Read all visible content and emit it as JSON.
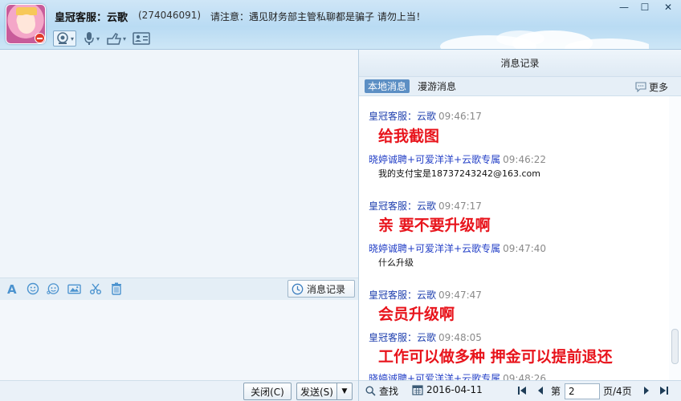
{
  "header": {
    "contact_name": "皇冠客服：云歌",
    "contact_id": "(274046091)",
    "notice": "请注意：遇见财务部主管私聊都是骗子 请勿上当！"
  },
  "toolbar": {
    "icons": [
      "video-icon",
      "microphone-icon",
      "share-icon",
      "contact-card-icon"
    ]
  },
  "window_controls": {
    "minimize": "—",
    "maximize": "☐",
    "close": "✕"
  },
  "input_toolbar": {
    "icons": [
      "font-icon",
      "emoji-icon",
      "magic-emoji-icon",
      "image-icon",
      "screenshot-icon",
      "trash-icon"
    ],
    "history_label": "消息记录"
  },
  "bottom": {
    "close_label": "关闭(C)",
    "send_label": "发送(S)"
  },
  "history": {
    "title": "消息记录",
    "tabs": [
      "本地消息",
      "漫游消息"
    ],
    "more_label": "更多",
    "messages": [
      {
        "sender": "皇冠客服：云歌",
        "time": "09:46:17",
        "text": "给我截图",
        "style": "big",
        "from": "cs"
      },
      {
        "sender": "晓婷诚聘+可爱洋洋+云歌专属",
        "time": "09:46:22",
        "text": "我的支付宝是18737243242@163.com",
        "style": "small",
        "from": "me"
      },
      {
        "sender": "皇冠客服：云歌",
        "time": "09:47:17",
        "text": "亲 要不要升级啊",
        "style": "big",
        "from": "cs"
      },
      {
        "sender": "晓婷诚聘+可爱洋洋+云歌专属",
        "time": "09:47:40",
        "text": "什么升级",
        "style": "small",
        "from": "me"
      },
      {
        "sender": "皇冠客服：云歌",
        "time": "09:47:47",
        "text": "会员升级啊",
        "style": "big",
        "from": "cs"
      },
      {
        "sender": "皇冠客服：云歌",
        "time": "09:48:05",
        "text": "工作可以做多种 押金可以提前退还",
        "style": "big",
        "from": "cs"
      },
      {
        "sender": "晓婷诚聘+可爱洋洋+云歌专属",
        "time": "09:48:26",
        "text": "",
        "style": "small",
        "from": "me"
      }
    ],
    "footer": {
      "search_label": "查找",
      "date": "2016-04-11",
      "page_prefix": "第",
      "page_value": "2",
      "page_suffix": "页/4页"
    }
  }
}
